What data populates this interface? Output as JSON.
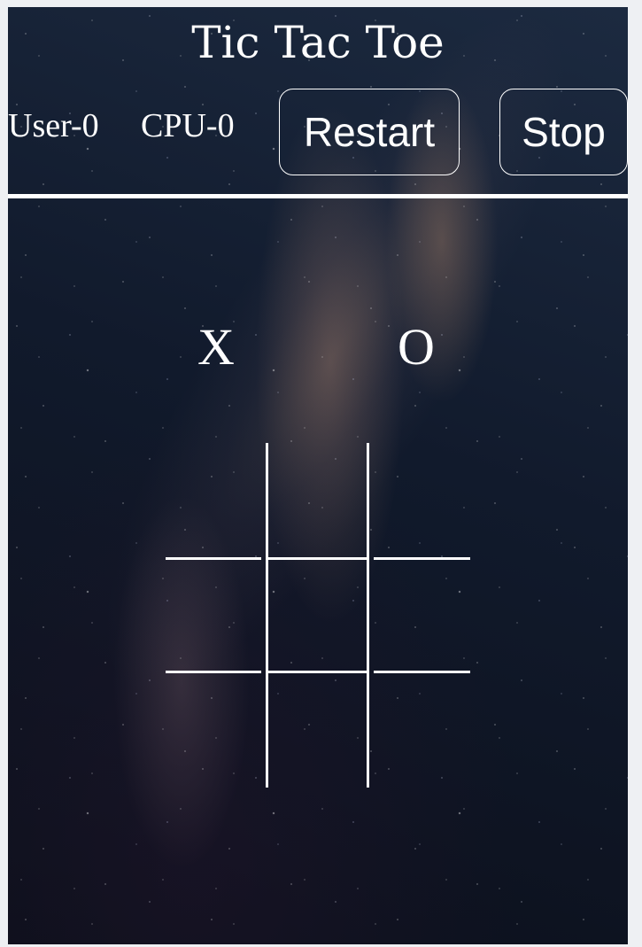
{
  "title": "Tic Tac Toe",
  "scores": {
    "user": "User-0",
    "cpu": "CPU-0"
  },
  "buttons": {
    "restart": "Restart",
    "stop": "Stop"
  },
  "symbols": {
    "x": "X",
    "o": "O"
  },
  "board": {
    "cells": [
      "",
      "",
      "",
      "",
      "",
      "",
      "",
      "",
      ""
    ]
  },
  "colors": {
    "foreground": "#ffffff",
    "background": "#0d1526"
  }
}
